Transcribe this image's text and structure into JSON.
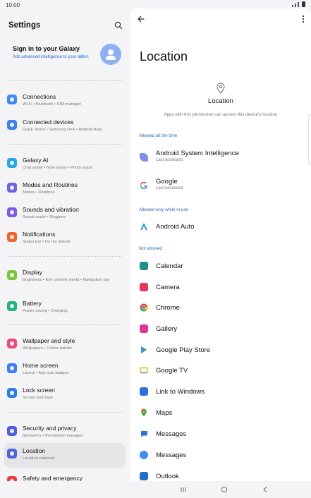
{
  "status": {
    "time": "10:00"
  },
  "settings": {
    "title": "Settings",
    "account": {
      "title": "Sign in to your Galaxy",
      "subtitle": "Add advanced intelligence to your tablet."
    },
    "items": [
      {
        "label": "Connections",
        "sub": "Wi-Fi • Bluetooth • SIM manager",
        "color": "#3d8af7",
        "icon": "wifi-icon"
      },
      {
        "label": "Connected devices",
        "sub": "Quick Share • Samsung DeX • Android Auto",
        "color": "#3d7ef0",
        "icon": "devices-icon"
      },
      {
        "label": "Galaxy AI",
        "sub": "Chat assist • Note assist • Photo assist",
        "color": "#27a6e6",
        "icon": "ai-icon"
      },
      {
        "label": "Modes and Routines",
        "sub": "Modes • Routines",
        "color": "#6e63e0",
        "icon": "modes-icon"
      },
      {
        "label": "Sounds and vibration",
        "sub": "Sound mode • Ringtone",
        "color": "#7a5fe6",
        "icon": "sound-icon"
      },
      {
        "label": "Notifications",
        "sub": "Status bar • Do not disturb",
        "color": "#f2622e",
        "icon": "notifications-icon"
      },
      {
        "label": "Display",
        "sub": "Brightness • Eye comfort shield • Navigation bar",
        "color": "#7ec43a",
        "icon": "display-icon"
      },
      {
        "label": "Battery",
        "sub": "Power saving • Charging",
        "color": "#22b27a",
        "icon": "battery-icon"
      },
      {
        "label": "Wallpaper and style",
        "sub": "Wallpapers • Colour palette",
        "color": "#e8507a",
        "icon": "wallpaper-icon"
      },
      {
        "label": "Home screen",
        "sub": "Layout • App icon badges",
        "color": "#3d7ef0",
        "icon": "home-icon"
      },
      {
        "label": "Lock screen",
        "sub": "Screen lock type",
        "color": "#2f7ee8",
        "icon": "lock-icon"
      },
      {
        "label": "Security and privacy",
        "sub": "Biometrics • Permission manager",
        "color": "#4f62e0",
        "icon": "shield-icon"
      },
      {
        "label": "Location",
        "sub": "Location requests",
        "color": "#4f62e0",
        "icon": "location-icon"
      },
      {
        "label": "Safety and emergency",
        "sub": "",
        "color": "#e84040",
        "icon": "emergency-icon"
      }
    ]
  },
  "location": {
    "title": "Location",
    "permission_label": "Location",
    "permission_desc": "Apps with this permission can access this device's location",
    "sections": {
      "all_time": "Allowed all the time",
      "while_in_use": "Allowed only while in use",
      "not_allowed": "Not allowed"
    },
    "apps": [
      {
        "name": "Android System Intelligence",
        "sub": "Last accessed",
        "color": "#7b8fe8",
        "icon": "asi-icon"
      },
      {
        "name": "Google",
        "sub": "Last accessed",
        "color": "#4285f4",
        "icon": "google-icon"
      },
      {
        "name": "Android Auto",
        "sub": "",
        "color": "#2a9bd6",
        "icon": "android-auto-icon"
      },
      {
        "name": "Calendar",
        "sub": "",
        "color": "#1f8f8a",
        "icon": "calendar-icon"
      },
      {
        "name": "Camera",
        "sub": "",
        "color": "#e8365a",
        "icon": "camera-icon"
      },
      {
        "name": "Chrome",
        "sub": "",
        "color": "#dd4b39",
        "icon": "chrome-icon"
      },
      {
        "name": "Gallery",
        "sub": "",
        "color": "#d93a8f",
        "icon": "gallery-icon"
      },
      {
        "name": "Google Play Store",
        "sub": "",
        "color": "#2fa84f",
        "icon": "play-store-icon"
      },
      {
        "name": "Google TV",
        "sub": "",
        "color": "#f2b400",
        "icon": "google-tv-icon"
      },
      {
        "name": "Link to Windows",
        "sub": "",
        "color": "#2f6fd8",
        "icon": "link-windows-icon"
      },
      {
        "name": "Maps",
        "sub": "",
        "color": "#34a853",
        "icon": "maps-icon"
      },
      {
        "name": "Messages",
        "sub": "",
        "color": "#2f6fd8",
        "icon": "messages-icon"
      },
      {
        "name": "Messages",
        "sub": "",
        "color": "#3b8ef0",
        "icon": "messages-icon"
      },
      {
        "name": "Outlook",
        "sub": "",
        "color": "#1f6fc9",
        "icon": "outlook-icon"
      }
    ]
  }
}
